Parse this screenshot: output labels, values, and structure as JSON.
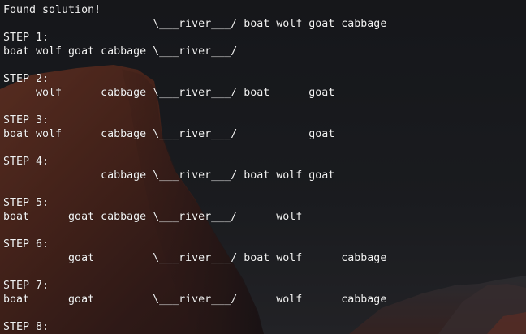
{
  "terminal": {
    "lines": [
      "Found solution!",
      "                       \\___river___/ boat wolf goat cabbage",
      "STEP 1:",
      "boat wolf goat cabbage \\___river___/",
      "",
      "STEP 2:",
      "     wolf      cabbage \\___river___/ boat      goat",
      "",
      "STEP 3:",
      "boat wolf      cabbage \\___river___/           goat",
      "",
      "STEP 4:",
      "               cabbage \\___river___/ boat wolf goat",
      "",
      "STEP 5:",
      "boat      goat cabbage \\___river___/      wolf",
      "",
      "STEP 6:",
      "          goat         \\___river___/ boat wolf      cabbage",
      "",
      "STEP 7:",
      "boat      goat         \\___river___/      wolf      cabbage",
      "",
      "STEP 8:"
    ]
  }
}
